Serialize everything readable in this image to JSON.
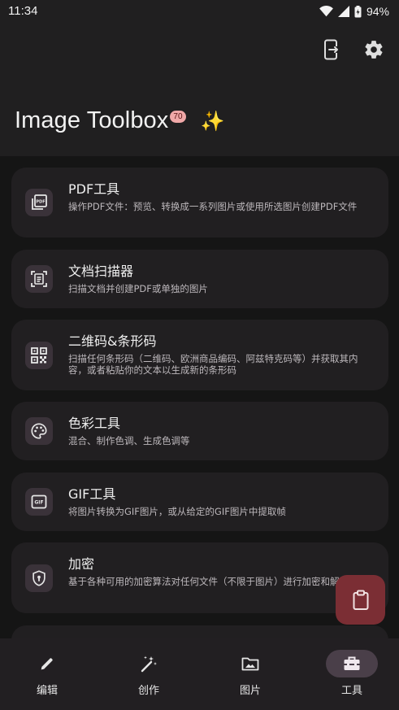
{
  "status": {
    "time": "11:34",
    "battery": "94%"
  },
  "app": {
    "title": "Image Toolbox",
    "badge": "70",
    "sparkle": "✨"
  },
  "tools": [
    {
      "title": "PDF工具",
      "desc": "操作PDF文件：预览、转换成一系列图片或使用所选图片创建PDF文件",
      "icon": "pdf-icon"
    },
    {
      "title": "文档扫描器",
      "desc": "扫描文档并创建PDF或单独的图片",
      "icon": "document-scanner-icon"
    },
    {
      "title": "二维码&条形码",
      "desc": "扫描任何条形码（二维码、欧洲商品编码、阿兹特克码等）并获取其内容，或者粘贴你的文本以生成新的条形码",
      "icon": "qr-code-icon"
    },
    {
      "title": "色彩工具",
      "desc": "混合、制作色调、生成色调等",
      "icon": "palette-icon"
    },
    {
      "title": "GIF工具",
      "desc": "将图片转换为GIF图片，或从给定的GIF图片中提取帧",
      "icon": "gif-icon"
    },
    {
      "title": "加密",
      "desc": "基于各种可用的加密算法对任何文件（不限于图片）进行加密和解密",
      "icon": "shield-lock-icon"
    }
  ],
  "nav": [
    {
      "label": "编辑",
      "icon": "pencil-icon"
    },
    {
      "label": "创作",
      "icon": "magic-wand-icon"
    },
    {
      "label": "图片",
      "icon": "image-folder-icon"
    },
    {
      "label": "工具",
      "icon": "toolbox-icon",
      "active": true
    }
  ],
  "colors": {
    "accent": "#7b2e34",
    "badge": "#f0a8a8",
    "card": "#211f21",
    "nav_active": "#4a3f49"
  }
}
